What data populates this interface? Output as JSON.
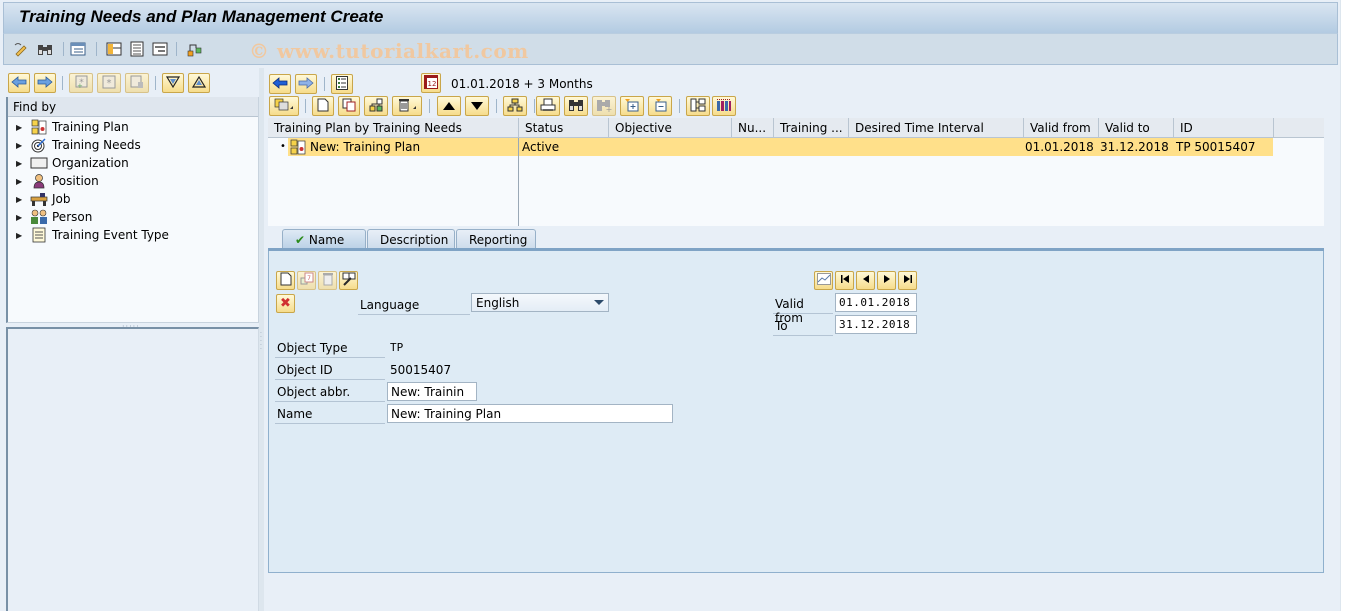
{
  "window": {
    "title": "Training Needs and Plan Management Create",
    "watermark": "© www.tutorialkart.com"
  },
  "app_toolbar": {
    "icons": [
      "edit-pencil-icon",
      "binoculars-icon",
      "list-view-icon",
      "layout-icon",
      "detail-list-icon",
      "form-view-icon",
      "hierarchy-icon"
    ]
  },
  "left_panel": {
    "toolbar": [
      "back-arrow-icon",
      "forward-arrow-icon",
      "new-selection-icon",
      "refresh-selection-icon",
      "delete-selection-icon",
      "expand-all-icon",
      "collapse-all-icon"
    ],
    "header": "Find by",
    "items": [
      {
        "label": "Training Plan",
        "icon": "training-plan-icon"
      },
      {
        "label": "Training Needs",
        "icon": "target-icon"
      },
      {
        "label": "Organization",
        "icon": "org-unit-icon"
      },
      {
        "label": "Position",
        "icon": "person-position-icon"
      },
      {
        "label": "Job",
        "icon": "job-icon"
      },
      {
        "label": "Person",
        "icon": "persons-icon"
      },
      {
        "label": "Training Event Type",
        "icon": "document-icon"
      }
    ]
  },
  "right_panel": {
    "date_range": "01.01.2018  + 3 Months",
    "grid": {
      "columns": [
        "Training Plan by Training Needs",
        "Status",
        "Objective",
        "Nu...",
        "Training ...",
        "Desired Time Interval",
        "Valid from",
        "Valid to",
        "ID"
      ],
      "rows": [
        {
          "name": "New: Training Plan",
          "status": "Active",
          "objective": "",
          "number": "",
          "training": "",
          "desired_interval": "",
          "valid_from": "01.01.2018",
          "valid_to": "31.12.2018",
          "id": "TP 50015407"
        }
      ]
    },
    "tabs": [
      {
        "label": "Name",
        "active": true
      },
      {
        "label": "Description",
        "active": false
      },
      {
        "label": "Reporting",
        "active": false
      }
    ],
    "form": {
      "language_label": "Language",
      "language_value": "English",
      "valid_from_label": "Valid from",
      "valid_from_value": "01.01.2018",
      "to_label": "To",
      "to_value": "31.12.2018",
      "object_type_label": "Object Type",
      "object_type_value": "TP",
      "object_id_label": "Object ID",
      "object_id_value": "50015407",
      "object_abbr_label": "Object abbr.",
      "object_abbr_value": "New: Trainin",
      "name_label": "Name",
      "name_value": "New: Training Plan"
    }
  }
}
